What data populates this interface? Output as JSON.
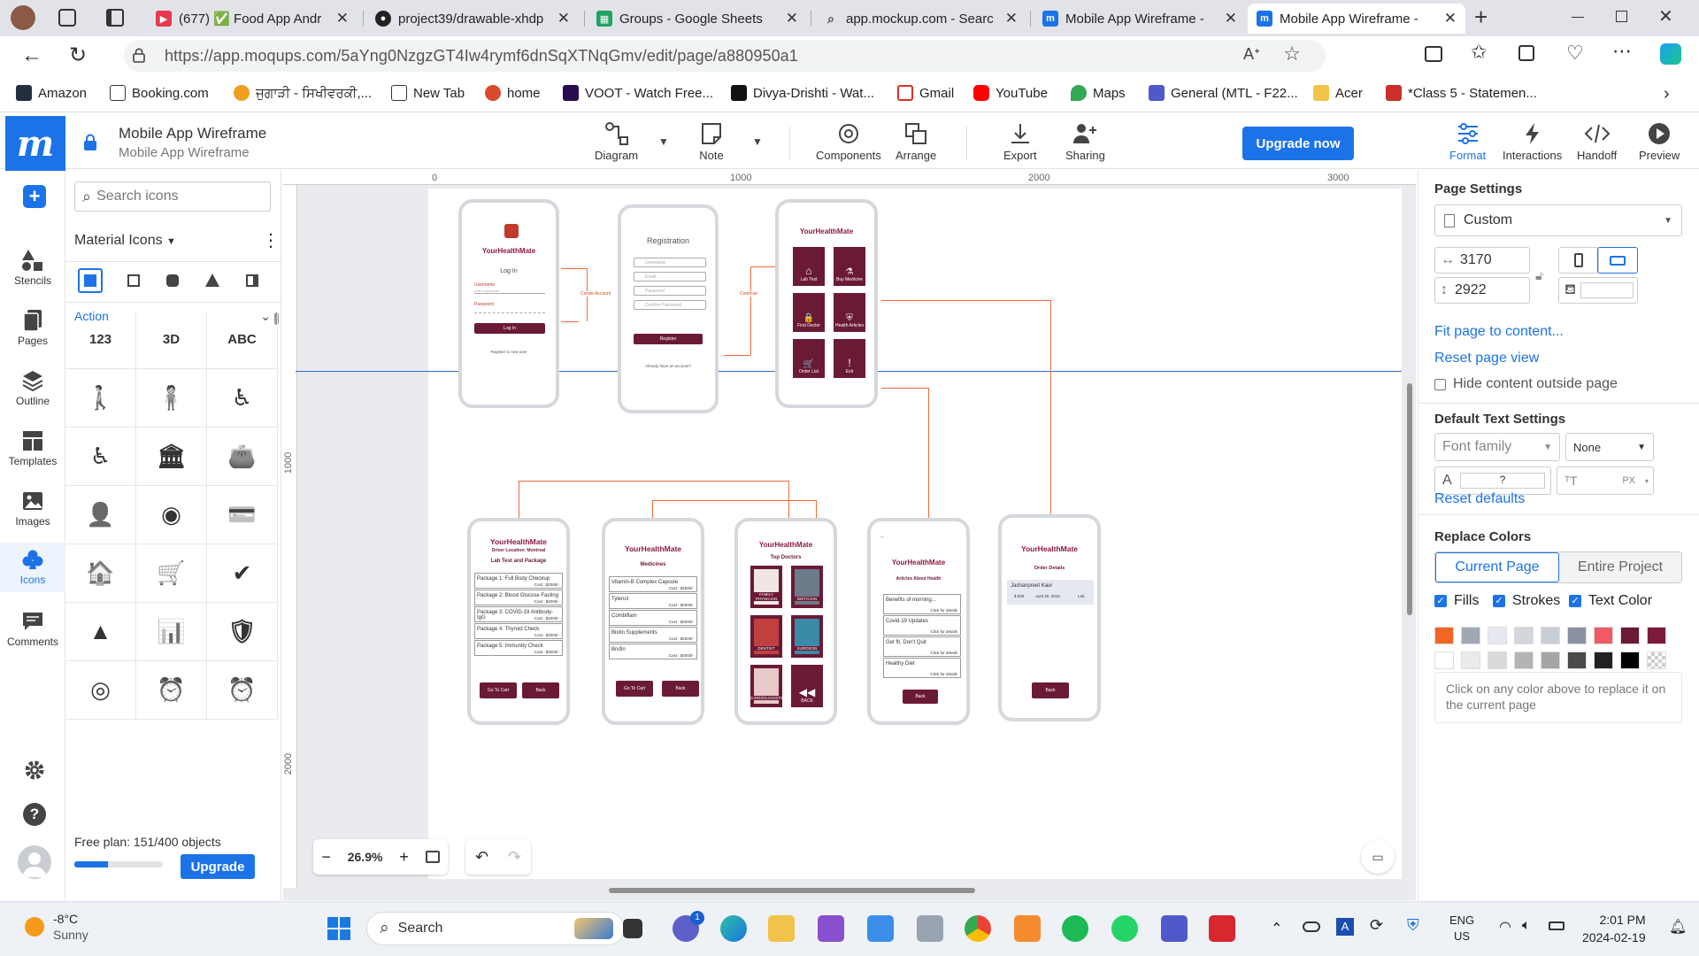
{
  "browser": {
    "tabs": [
      {
        "label": "",
        "icon": "profile-avatar"
      },
      {
        "label": "",
        "icon": "workspaces-icon"
      },
      {
        "label": "",
        "icon": "tab-actions-icon"
      },
      {
        "label": "(677) ✅ Food App Andr",
        "icon": "youtube-icon"
      },
      {
        "label": "project39/drawable-xhdp",
        "icon": "github-icon"
      },
      {
        "label": "Groups - Google Sheets",
        "icon": "sheets-icon"
      },
      {
        "label": "app.mockup.com - Searc",
        "icon": "search-icon"
      },
      {
        "label": "Mobile App Wireframe -",
        "icon": "moqups-icon"
      },
      {
        "label": "Mobile App Wireframe -",
        "icon": "moqups-icon"
      }
    ],
    "url": "https://app.moqups.com/5aYng0NzgzGT4Iw4rymf6dnSqXTNqGmv/edit/page/a880950a1",
    "bookmarks": [
      "Amazon",
      "Booking.com",
      "ਜੁਗਾੜੀ - ਸਿਖੀਵਰਕੀ,...",
      "New Tab",
      "home",
      "VOOT - Watch Free...",
      "Divya-Drishti - Wat...",
      "Gmail",
      "YouTube",
      "Maps",
      "General (MTL - F22...",
      "Acer",
      "*Class 5 - Statemen..."
    ]
  },
  "app": {
    "project_title": "Mobile App Wireframe",
    "page_name": "Mobile App Wireframe",
    "toolbar": {
      "diagram": "Diagram",
      "note": "Note",
      "components": "Components",
      "arrange": "Arrange",
      "export": "Export",
      "sharing": "Sharing",
      "upgrade_now": "Upgrade now",
      "format": "Format",
      "interactions": "Interactions",
      "handoff": "Handoff",
      "preview": "Preview"
    },
    "rail": [
      "Stencils",
      "Pages",
      "Outline",
      "Templates",
      "Images",
      "Icons",
      "Comments"
    ],
    "icons_panel": {
      "search_placeholder": "Search icons",
      "library": "Material Icons",
      "category": "Action",
      "glyph_labels": [
        "123",
        "3D",
        "ABC"
      ],
      "plan_text": "Free plan: 151/400 objects",
      "plan_progress": 0.3775,
      "upgrade": "Upgrade"
    },
    "canvas": {
      "zoom": "26.9%",
      "ruler_top": [
        "0",
        "1000",
        "2000",
        "3000"
      ],
      "ruler_left": [
        "1000",
        "2000"
      ]
    },
    "wireframes": {
      "login": {
        "brand": "YourHealthMate",
        "heading": "Log In",
        "username_label": "Username",
        "username_ph": "enter username",
        "password_label": "Password",
        "button": "Log In",
        "footer": "Register to new user"
      },
      "registration": {
        "heading": "Registration",
        "fields": [
          "Username",
          "Email",
          "Password",
          "Confirm Password"
        ],
        "button": "Register",
        "footer": "Already have an account?"
      },
      "home": {
        "brand": "YourHealthMate",
        "tiles": [
          "Lab Test",
          "Buy Medicine",
          "Find Doctor",
          "Health Articles",
          "Order List",
          "Exit"
        ]
      },
      "lab": {
        "brand": "YourHealthMate",
        "sub1": "Driver Location: Montreal",
        "sub2": "Lab Test and Package",
        "items": [
          "Package 1: Full Body Checkup",
          "Package 2: Blood Glucose Fasting",
          "Package 3: COVID-19 Antibody-IgG",
          "Package 4: Thyroid Check",
          "Package 5: Immunity Check"
        ],
        "cost": "Cost : $2000/-",
        "buttons": [
          "Go To Cart",
          "Back"
        ]
      },
      "medicines": {
        "brand": "YourHealthMate",
        "sub": "Medicines",
        "items": [
          "Vitamin-B Complex Capsule",
          "Tylenol",
          "Combiflam",
          "Biotin Supplements",
          "Brufin"
        ],
        "cost": "Cost : $2000/-",
        "buttons": [
          "Go To Cart",
          "Back"
        ]
      },
      "doctors": {
        "brand": "YourHealthMate",
        "sub": "Top Doctors",
        "tiles": [
          "FAMILY PHYSICIAN",
          "DIETICIAN",
          "DENTIST",
          "SURGEON",
          "CARDIOLOGISTS",
          "BACK"
        ]
      },
      "articles": {
        "brand": "YourHealthMate",
        "sub": "Articles About Health",
        "items": [
          "Benefits of morning...",
          "Covid-19 Updates",
          "Get fit, Don't Quit",
          "Healthy Diet"
        ],
        "detail": "Click for details",
        "button": "Back"
      },
      "orders": {
        "brand": "YourHealthMate",
        "sub": "Order Details",
        "name": "Jashanpreet Kaur",
        "amount": "$ 500",
        "date": "April 20, 2015",
        "type": "Lab",
        "button": "Back"
      },
      "connector_labels": [
        "Create Account",
        "Continue"
      ]
    },
    "right_panel": {
      "page_settings": "Page Settings",
      "preset": "Custom",
      "width": "3170",
      "height": "2922",
      "fit": "Fit page to content...",
      "reset_view": "Reset page view",
      "hide_outside": "Hide content outside page",
      "text_settings": "Default Text Settings",
      "font_family": "Font family",
      "font_style": "None",
      "font_color_value": "?",
      "font_size_unit": "PX",
      "reset_defaults": "Reset defaults",
      "replace_colors": "Replace Colors",
      "tab_current": "Current Page",
      "tab_entire": "Entire Project",
      "chk_fills": "Fills",
      "chk_strokes": "Strokes",
      "chk_text": "Text Color",
      "hint": "Click on any color above to replace it on the current page",
      "swatches": [
        "#f26522",
        "#a0a8b3",
        "#e6e8f0",
        "#d3d6dc",
        "#c9ced6",
        "#8a92a1",
        "#ef5a64",
        "#6b1a34",
        "#7d1a3c",
        "#ffffff",
        "#ebebeb",
        "#dadada",
        "#b4b4b4",
        "#a5a5a5",
        "#4a4a4a",
        "#222222",
        "#000000",
        "transparent"
      ]
    }
  },
  "taskbar": {
    "weather_temp": "-8°C",
    "weather_desc": "Sunny",
    "search": "Search",
    "lang1": "ENG",
    "lang2": "US",
    "time": "2:01 PM",
    "date": "2024-02-19"
  }
}
